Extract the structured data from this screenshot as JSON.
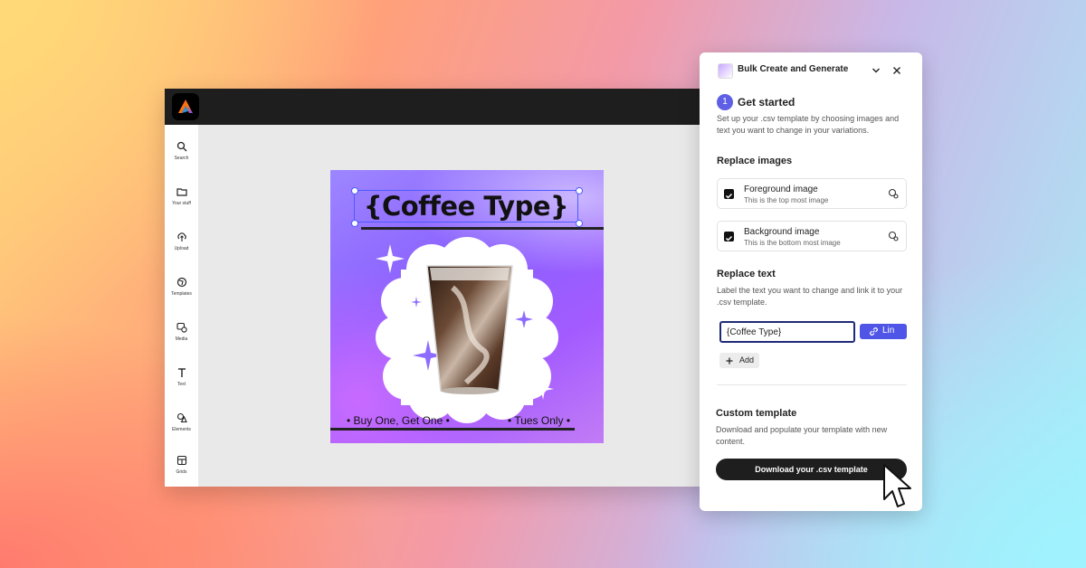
{
  "sidebar": {
    "items": [
      {
        "label": "Search",
        "icon": "search-icon"
      },
      {
        "label": "Your stuff",
        "icon": "folder-icon"
      },
      {
        "label": "Upload",
        "icon": "upload-icon"
      },
      {
        "label": "Templates",
        "icon": "templates-icon"
      },
      {
        "label": "Media",
        "icon": "media-icon"
      },
      {
        "label": "Text",
        "icon": "text-icon"
      },
      {
        "label": "Elements",
        "icon": "elements-icon"
      },
      {
        "label": "Grids",
        "icon": "grids-icon"
      }
    ]
  },
  "canvas": {
    "title": "{Coffee Type}",
    "footer_left": "• Buy One, Get One •",
    "footer_right": "• Tues Only •"
  },
  "panel": {
    "title": "Bulk Create and Generate",
    "step_number": "1",
    "get_started": "Get started",
    "get_started_desc": "Set up your .csv template by choosing images and text you want to change in your variations.",
    "replace_images": {
      "heading": "Replace images",
      "items": [
        {
          "title": "Foreground image",
          "subtitle": "This is the top most image",
          "checked": true
        },
        {
          "title": "Background image",
          "subtitle": "This is the bottom most image",
          "checked": true
        }
      ]
    },
    "replace_text": {
      "heading": "Replace text",
      "desc": "Label the text you want to change and link it to your .csv template.",
      "input_value": "{Coffee Type}",
      "link_label": "Lin",
      "add_label": "Add"
    },
    "custom_template": {
      "heading": "Custom template",
      "desc": "Download and populate your template with new content.",
      "download_label": "Download your .csv template"
    }
  },
  "colors": {
    "accent": "#5f5fe6",
    "link_button": "#4f55e6",
    "topbar": "#1e1e1e",
    "poster_purple": "#8b60ff"
  }
}
